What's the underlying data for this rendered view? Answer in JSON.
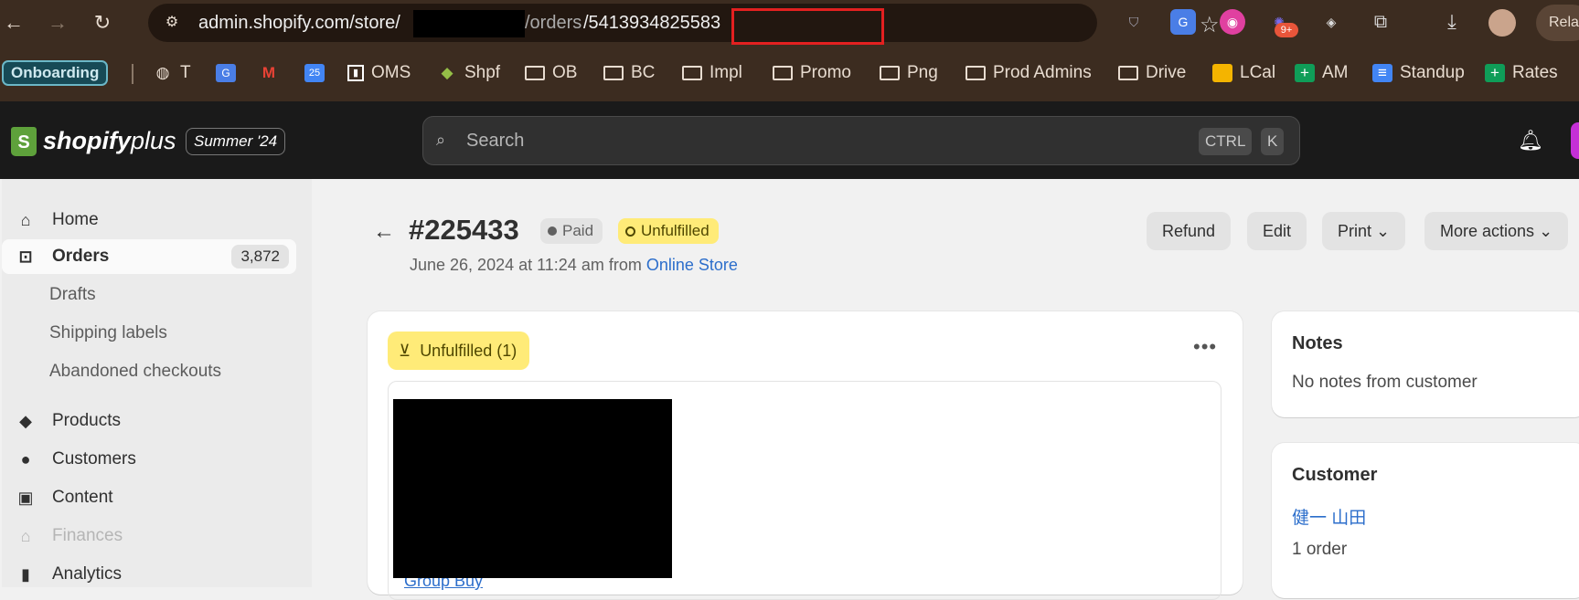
{
  "browser": {
    "url_prefix": "admin.shopify.com/store/",
    "url_middle": "/orders",
    "url_order_id": "/5413934825583",
    "extension_badge": "9+",
    "relaunch_label": "Rela",
    "bookmarks": {
      "onboarding": "Onboarding",
      "items": [
        "T",
        "",
        "",
        "",
        "OMS",
        "Shpf",
        "OB",
        "BC",
        "Impl",
        "Promo",
        "Png",
        "Prod Admins",
        "Drive",
        "LCal",
        "AM",
        "Standup",
        "Rates"
      ]
    }
  },
  "topbar": {
    "logo_bold": "shopify",
    "logo_light": "plus",
    "edition": "Summer '24",
    "search_placeholder": "Search",
    "kbd_ctrl": "CTRL",
    "kbd_k": "K"
  },
  "sidebar": {
    "home": "Home",
    "orders": "Orders",
    "orders_count": "3,872",
    "drafts": "Drafts",
    "shipping_labels": "Shipping labels",
    "abandoned_checkouts": "Abandoned checkouts",
    "products": "Products",
    "customers": "Customers",
    "content": "Content",
    "finances": "Finances",
    "analytics": "Analytics"
  },
  "order": {
    "number": "#225433",
    "payment_status": "Paid",
    "fulfillment_status": "Unfulfilled",
    "date_text": "June 26, 2024 at 11:24 am from ",
    "channel": "Online Store",
    "actions": {
      "refund": "Refund",
      "edit": "Edit",
      "print": "Print",
      "more": "More actions"
    },
    "fulfillment_card": {
      "tag": "Unfulfilled (1)",
      "product_link": "Group Buy"
    }
  },
  "notes": {
    "title": "Notes",
    "text": "No notes from customer"
  },
  "customer": {
    "title": "Customer",
    "name": "健一 山田",
    "orders": "1 order"
  }
}
